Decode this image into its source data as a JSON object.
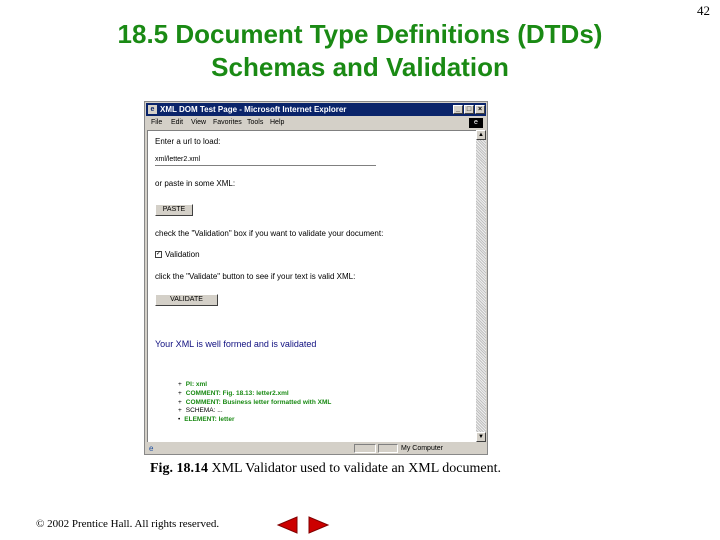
{
  "slide": {
    "title_line1": "18.5  Document Type Definitions (DTDs)",
    "title_line2": "Schemas and Validation",
    "page_number": "42",
    "caption_fig": "Fig. 18.14",
    "caption_text": " XML Validator used to validate an XML document.",
    "copyright": "© 2002 Prentice Hall.  All rights reserved."
  },
  "window": {
    "title": "XML DOM Test Page - Microsoft Internet Explorer",
    "menu": [
      "File",
      "Edit",
      "View",
      "Favorites",
      "Tools",
      "Help"
    ],
    "status_zone": "My Computer"
  },
  "page": {
    "prompt_url": "Enter a url to load:",
    "url_value": "xml/letter2.xml",
    "prompt_paste": "or paste in some XML:",
    "paste_label": "PASTE",
    "prompt_check": "check the \"Validation\" box if you want to validate your document:",
    "checkbox_label": "Validation",
    "prompt_validate": "click the \"Validate\" button to see if your text is valid XML:",
    "validate_label": "VALIDATE",
    "result": "Your XML is well formed and is validated",
    "tree": [
      {
        "bullet": "+",
        "text": "PI: xml",
        "style": "g"
      },
      {
        "bullet": "+",
        "text": "COMMENT: Fig. 18.13: letter2.xml",
        "style": "g"
      },
      {
        "bullet": "+",
        "text": "COMMENT: Business letter formatted with XML",
        "style": "g"
      },
      {
        "bullet": "+",
        "text": "SCHEMA: ...",
        "style": "k"
      },
      {
        "bullet": "•",
        "text": "ELEMENT: letter",
        "style": "g"
      }
    ]
  },
  "colors": {
    "title": "#1a8a14",
    "titlebar": "#0a246a",
    "result": "#101080",
    "nav_arrow": "#cc0000"
  },
  "icons": {
    "app": "ie-page-icon",
    "status": "ie-globe-icon",
    "nav_prev": "triangle-left-icon",
    "nav_next": "triangle-right-icon"
  }
}
